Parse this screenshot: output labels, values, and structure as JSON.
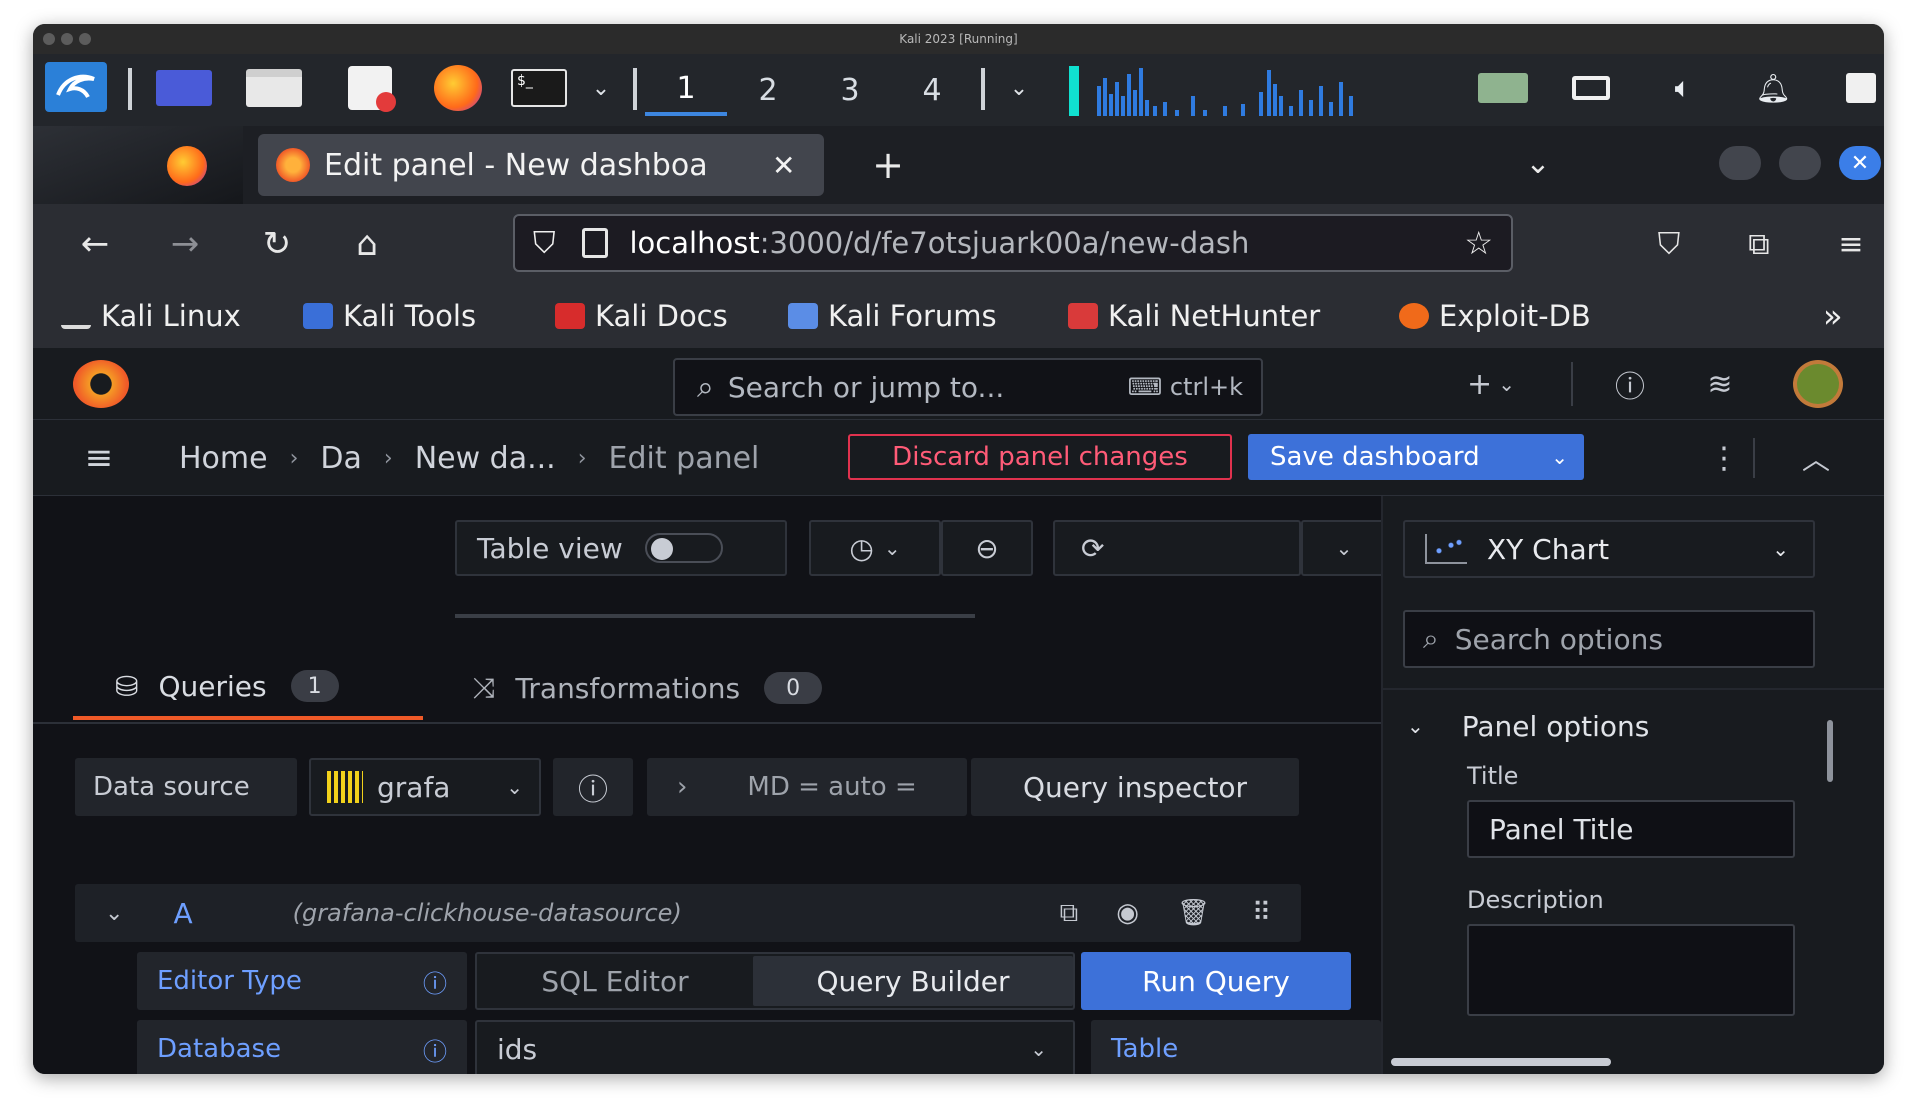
{
  "window": {
    "title": "Kali 2023 [Running]"
  },
  "kali_panel": {
    "workspaces": [
      "1",
      "2",
      "3",
      "4"
    ],
    "active_workspace": "1",
    "icons": [
      "kali-menu-icon",
      "show-desktop-icon",
      "file-manager-icon",
      "text-editor-icon",
      "firefox-icon",
      "terminal-icon",
      "chevron-down-icon",
      "network-graph",
      "network-icon",
      "display-icon",
      "volume-icon",
      "notifications-icon",
      "lock-icon"
    ]
  },
  "browser": {
    "tab_title": "Edit panel - New dashboa",
    "url_host": "localhost",
    "url_path": ":3000/d/fe7otsjuark00a/new-dash",
    "bookmarks": [
      "Kali Linux",
      "Kali Tools",
      "Kali Docs",
      "Kali Forums",
      "Kali NetHunter",
      "Exploit-DB"
    ]
  },
  "grafana": {
    "search_placeholder": "Search or jump to...",
    "search_shortcut": "ctrl+k",
    "breadcrumbs": [
      "Home",
      "Da",
      "New da...",
      "Edit panel"
    ],
    "discard_label": "Discard panel changes",
    "save_label": "Save dashboard",
    "table_view_label": "Table view",
    "tabs": [
      {
        "label": "Queries",
        "count": "1"
      },
      {
        "label": "Transformations",
        "count": "0"
      }
    ],
    "datasource_label": "Data source",
    "datasource_value": "grafa",
    "query_options": "MD = auto =",
    "query_inspector": "Query inspector",
    "query": {
      "ref": "A",
      "datasource": "(grafana-clickhouse-datasource)",
      "editor_type_label": "Editor Type",
      "editor_options": [
        "SQL Editor",
        "Query Builder"
      ],
      "run_label": "Run Query",
      "database_label": "Database",
      "database_value": "ids",
      "table_label": "Table"
    },
    "viz": {
      "type": "XY Chart",
      "search_placeholder": "Search options",
      "section": "Panel options",
      "title_label": "Title",
      "title_value": "Panel Title",
      "description_label": "Description"
    }
  }
}
